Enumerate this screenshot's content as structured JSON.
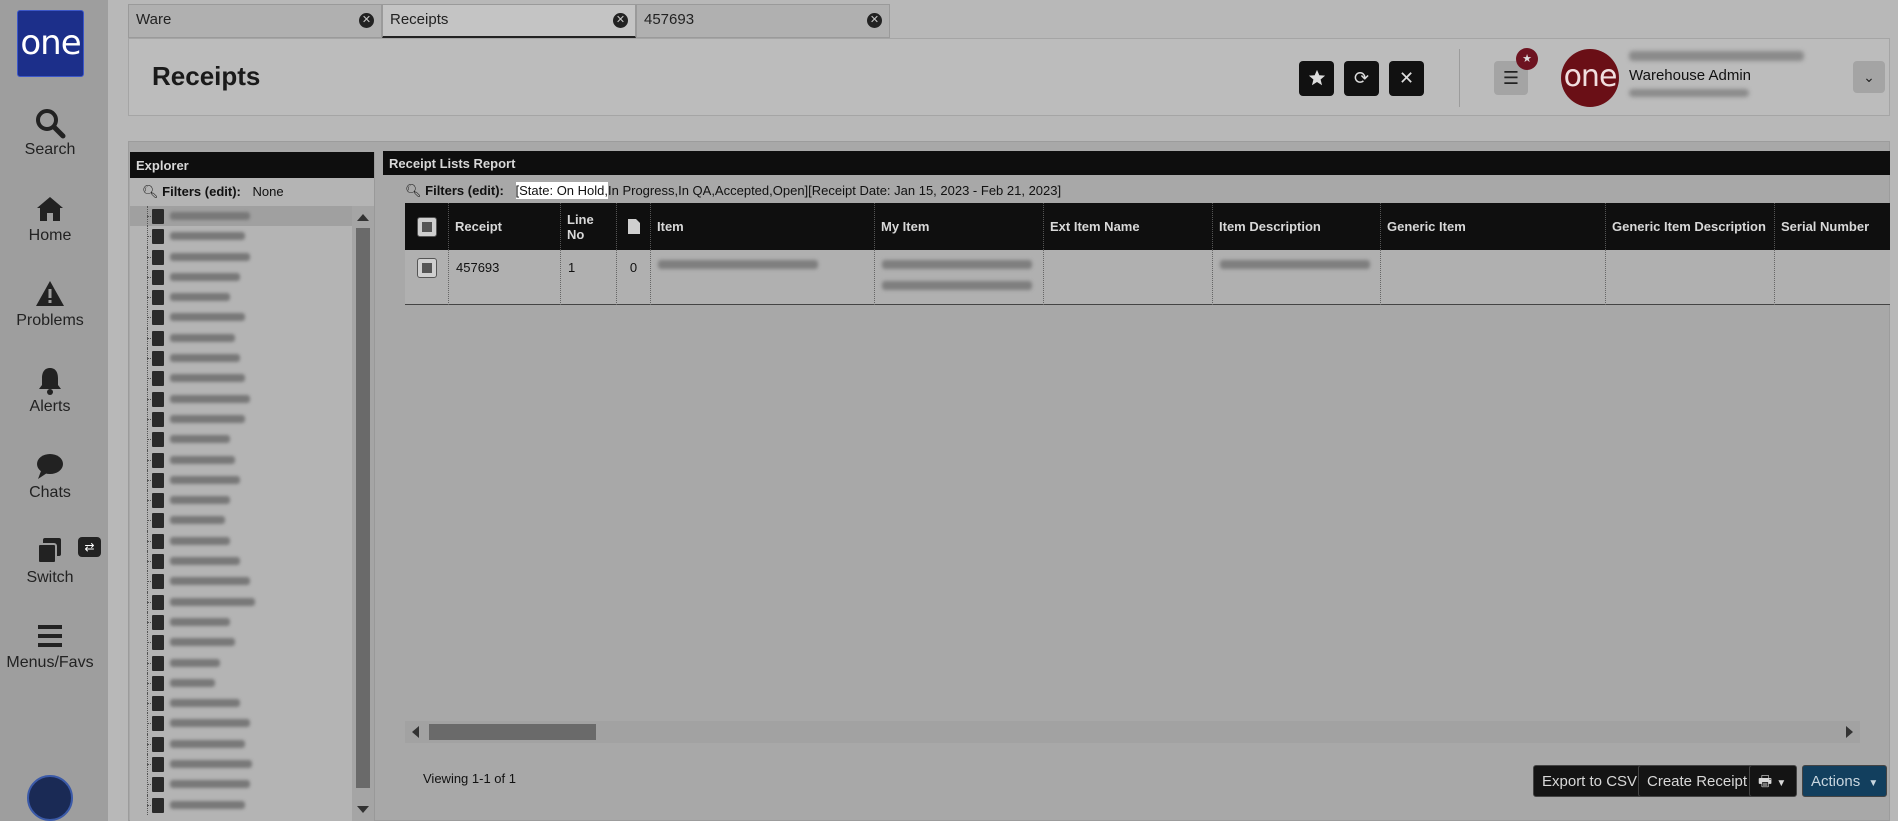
{
  "nav": {
    "logo": "one",
    "items": [
      {
        "label": "Search",
        "icon": "search-icon"
      },
      {
        "label": "Home",
        "icon": "home-icon"
      },
      {
        "label": "Problems",
        "icon": "warning-icon"
      },
      {
        "label": "Alerts",
        "icon": "bell-icon"
      },
      {
        "label": "Chats",
        "icon": "chat-icon"
      },
      {
        "label": "Switch",
        "icon": "switch-icon"
      },
      {
        "label": "Menus/Favs",
        "icon": "menu-icon"
      }
    ]
  },
  "tabs": [
    {
      "label": "Ware",
      "active": false
    },
    {
      "label": "Receipts",
      "active": true
    },
    {
      "label": "457693",
      "active": false
    }
  ],
  "header": {
    "title": "Receipts",
    "user_role": "Warehouse Admin",
    "avatar_text": "one"
  },
  "explorer": {
    "title": "Explorer",
    "filters_label": "Filters (edit):",
    "filters_value": "None",
    "tree_row_count": 30
  },
  "report": {
    "title": "Receipt Lists Report",
    "filters_label": "Filters (edit):",
    "filters_highlight": "[State: On Hold,",
    "filters_rest": "In Progress,In QA,Accepted,Open][Receipt Date: Jan 15, 2023 - Feb 21, 2023]",
    "columns": [
      "Receipt",
      "Line No",
      "Item",
      "My Item",
      "Ext Item Name",
      "Item Description",
      "Generic Item",
      "Generic Item Description",
      "Serial Number"
    ],
    "rows": [
      {
        "receipt": "457693",
        "line_no": "1",
        "attachments": "0"
      }
    ],
    "viewing": "Viewing 1-1 of 1",
    "buttons": {
      "export": "Export to CSV",
      "create": "Create Receipt",
      "actions": "Actions"
    }
  },
  "colors": {
    "logo_bg": "#1c2f8a",
    "avatar_bg": "#6a0f16",
    "actions_bg": "#123f5e",
    "panel_head": "#0e0e0e"
  }
}
